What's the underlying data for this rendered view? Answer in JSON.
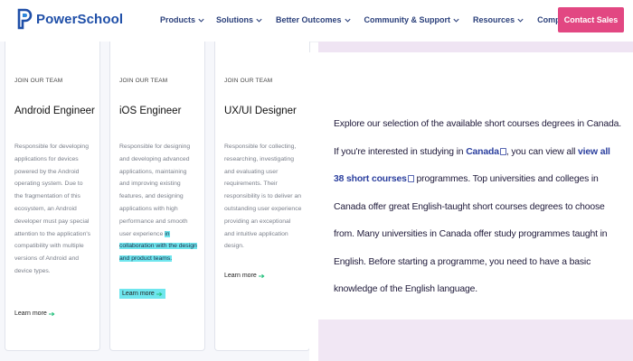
{
  "brand": {
    "name": "PowerSchool",
    "color": "#1f4fa8",
    "accent": "#e24782"
  },
  "nav": {
    "items": [
      {
        "label": "Products"
      },
      {
        "label": "Solutions"
      },
      {
        "label": "Better Outcomes"
      },
      {
        "label": "Community & Support"
      },
      {
        "label": "Resources"
      },
      {
        "label": "Company"
      }
    ],
    "cta_label": "Contact Sales"
  },
  "cards": [
    {
      "eyebrow": "JOIN OUR TEAM",
      "title": "Android Engineer",
      "desc": "Responsible for developing applications for devices powered by the Android operating system. Due to the fragmentation of this ecosystem, an Android developer must pay special attention to the application's compatibility with multiple versions of Android and device types.",
      "learn": "Learn more"
    },
    {
      "eyebrow": "JOIN OUR TEAM",
      "title": "iOS Engineer",
      "desc_plain": "Responsible for designing and developing advanced applications, maintaining and improving existing features, and designing applications with high performance and smooth user experience",
      "desc_highlight": "in collaboration with the design and product teams.",
      "learn": "Learn more"
    },
    {
      "eyebrow": "JOIN OUR TEAM",
      "title": "UX/UI Designer",
      "desc": "Responsible for collecting, researching, investigating and evaluating user requirements. Their responsibility is to deliver an outstanding user experience providing an exceptional and intuitive application design.",
      "learn": "Learn more"
    }
  ],
  "panel": {
    "p1": "Explore our selection of the available short courses degrees in Canada. If you're interested in studying in",
    "link1": "Canada",
    "p2": ", you can view all",
    "link2": "view all 38 short courses",
    "p3": "programmes. Top universities and colleges in Canada offer great English-taught short courses degrees to choose from. Many universities in Canada offer study programmes taught in English. Before starting a programme, you need to have a basic knowledge of the English language."
  },
  "colors": {
    "highlight": "#6fe6ee",
    "panel_band": "#f1e7f4",
    "learn_arrow": "#1fbf7a"
  }
}
